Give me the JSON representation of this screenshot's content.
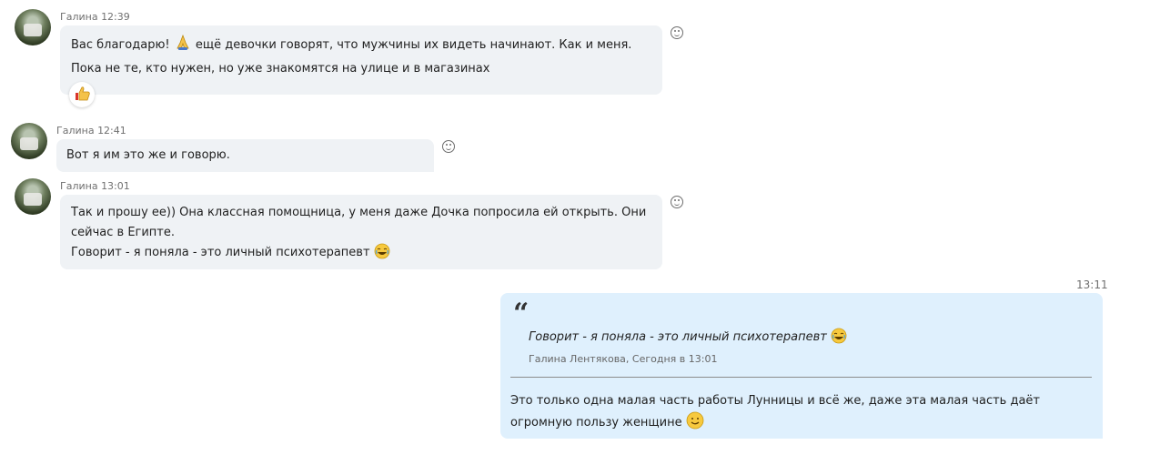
{
  "messages": [
    {
      "sender": "Галина",
      "time": "12:39",
      "text_before_emoji": "Вас благодарю! ",
      "emoji": "praying-hands",
      "text_after_emoji": " ещё девочки говорят, что мужчины их видеть начинают. Как и меня. Пока не те, кто нужен, но уже знакомятся на улице и в магазинах",
      "reaction": "thumbs-up"
    },
    {
      "sender": "Галина",
      "time": "12:41",
      "text": "Вот я им это же и говорю."
    },
    {
      "sender": "Галина",
      "time": "13:01",
      "line1": "Так и прошу ее)) Она классная помощница, у меня даже Дочка попросила ей открыть. Они сейчас в Египте.",
      "line2": "Говорит - я поняла - это личный психотерапевт ",
      "emoji": "laughing-face"
    }
  ],
  "outgoing": {
    "time": "13:11",
    "quote_mark": "“",
    "quote_text": "Говорит - я поняла - это личный психотерапевт ",
    "quote_emoji": "laughing-face",
    "quote_author": "Галина Лентякова, Сегодня в 13:01",
    "text": "Это только одна малая часть работы Лунницы и всё же, даже эта малая часть даёт огромную пользу женщине ",
    "emoji": "smiling-face"
  },
  "colors": {
    "incoming_bubble": "#eff2f5",
    "outgoing_bubble": "#dff0fd",
    "meta_text": "#707070"
  }
}
